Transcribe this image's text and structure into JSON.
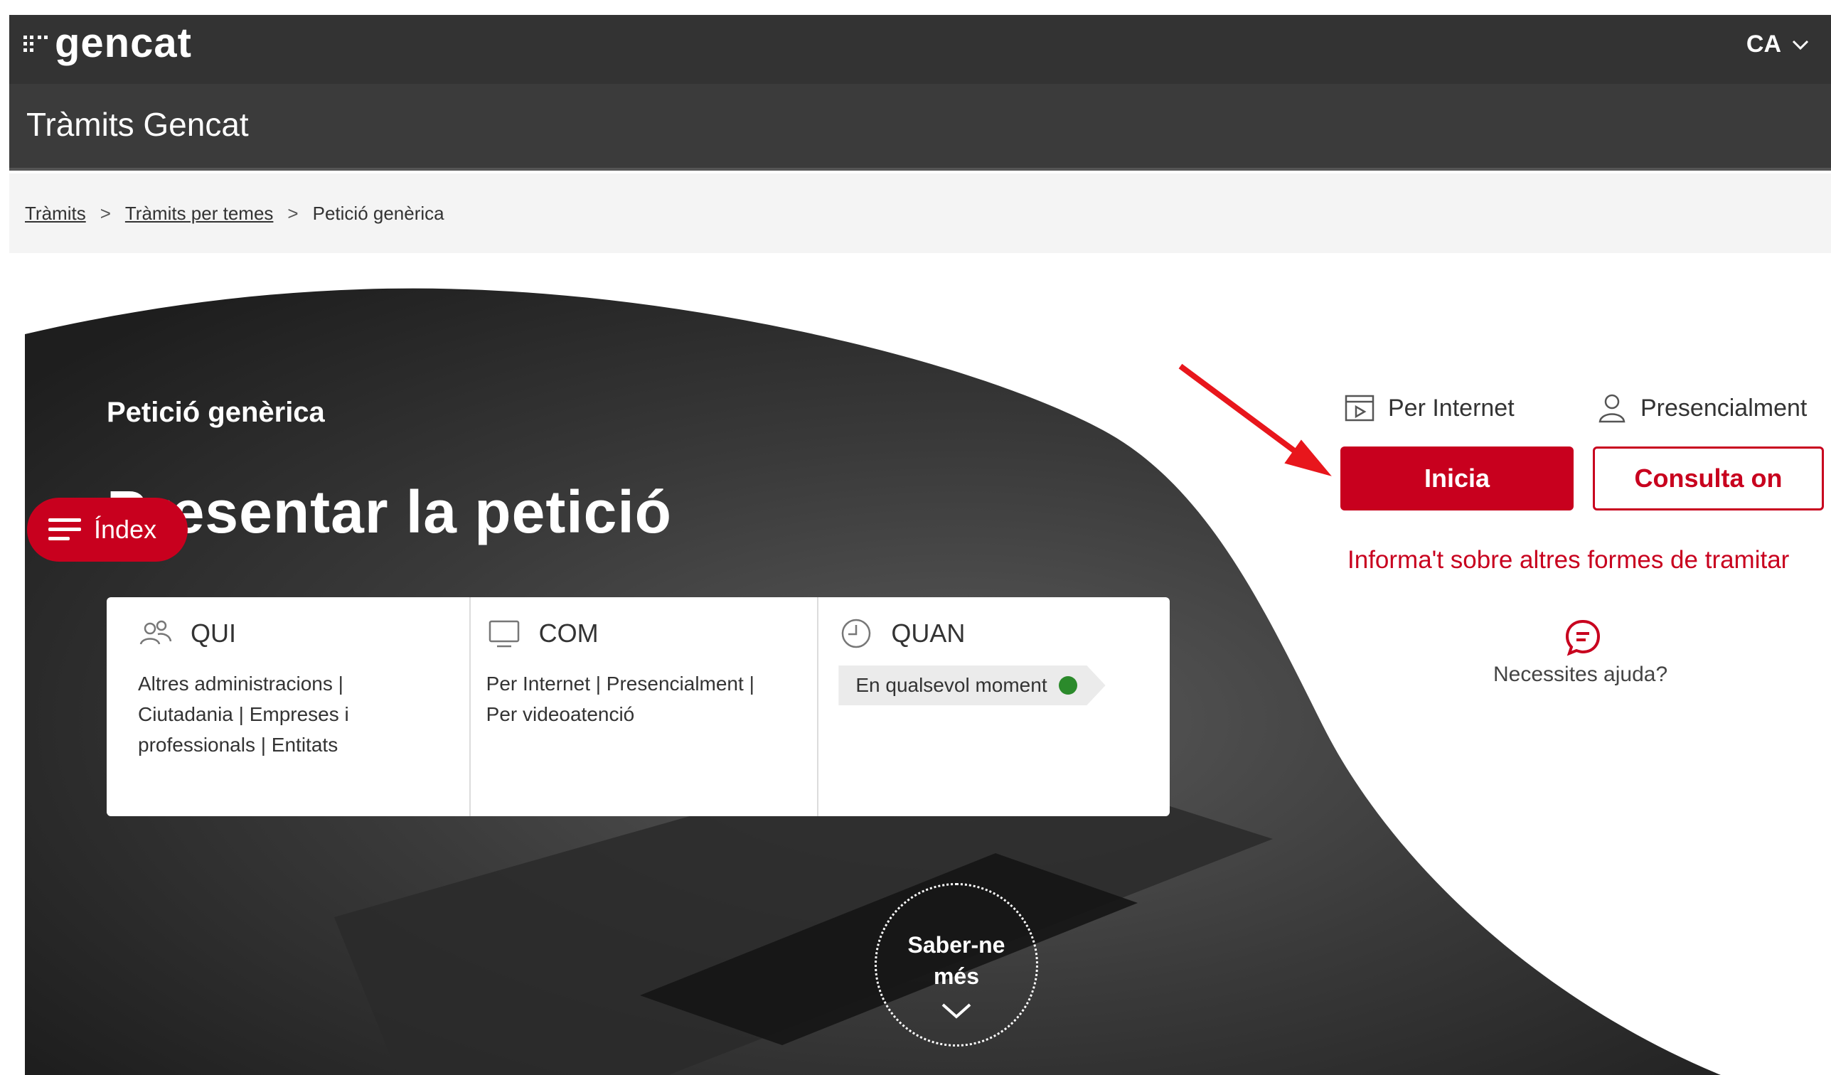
{
  "header": {
    "logo_text": "gencat",
    "language": "CA",
    "site_title": "Tràmits Gencat"
  },
  "breadcrumb": {
    "items": [
      "Tràmits",
      "Tràmits per temes",
      "Petició genèrica"
    ]
  },
  "hero": {
    "pretitle": "Petició genèrica",
    "title": "Presentar la petició",
    "index_label": "Índex",
    "saber_line1": "Saber-ne",
    "saber_line2": "més"
  },
  "info": {
    "qui": {
      "heading": "QUI",
      "text": "Altres administracions | Ciutadania | Empreses i professionals | Entitats"
    },
    "com": {
      "heading": "COM",
      "text": "Per Internet | Presencialment | Per videoatenció"
    },
    "quan": {
      "heading": "QUAN",
      "badge": "En qualsevol moment"
    }
  },
  "actions": {
    "internet_label": "Per Internet",
    "presencial_label": "Presencialment",
    "inicia_label": "Inicia",
    "consulta_label": "Consulta on",
    "other_ways_link": "Informa't sobre altres formes de tramitar",
    "help_label": "Necessites ajuda?"
  },
  "colors": {
    "brand_red": "#c8001e",
    "header_dark": "#333333",
    "status_green": "#2b8a2b",
    "annotation_arrow": "#e8161c"
  }
}
